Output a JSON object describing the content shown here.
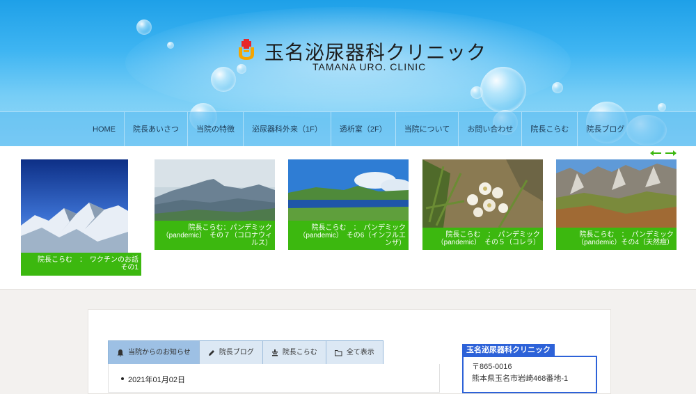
{
  "header": {
    "title": "玉名泌尿器科クリニック",
    "subtitle": "TAMANA URO. CLINIC"
  },
  "nav": {
    "items": [
      "HOME",
      "院長あいさつ",
      "当院の特徴",
      "泌尿器科外来（1F）",
      "透析室（2F）",
      "当院について",
      "お問い合わせ",
      "院長こらむ",
      "院長ブログ"
    ]
  },
  "slider": {
    "cards": [
      {
        "caption": "院長こらむ　：　ワクチンのお話　その1",
        "scene": "snow-mountain"
      },
      {
        "caption": "院長こらむ：パンデミック（pandemic）　その７（コロナウィルス）",
        "scene": "hazy-ridge"
      },
      {
        "caption": "院長こらむ　：　パンデミック（pandemic）　その6（インフルエンザ）",
        "scene": "mountain-lake"
      },
      {
        "caption": "院長こらむ　：　パンデミック（pandemic）　その５（コレラ）",
        "scene": "edelweiss"
      },
      {
        "caption": "院長こらむ　：　パンデミック（pandemic）その4（天然痘）",
        "scene": "alpine-valley"
      }
    ]
  },
  "tabs": [
    {
      "label": "当院からのお知らせ",
      "icon": "bell-icon"
    },
    {
      "label": "院長ブログ",
      "icon": "pencil-icon"
    },
    {
      "label": "院長こらむ",
      "icon": "column-icon"
    },
    {
      "label": "全て表示",
      "icon": "folder-icon"
    }
  ],
  "news": {
    "items": [
      {
        "date": "2021年01月02日"
      }
    ]
  },
  "sidebar": {
    "title": "玉名泌尿器科クリニック",
    "postal": "〒865-0016",
    "address": "熊本県玉名市岩崎468番地-1"
  },
  "colors": {
    "accent_green": "#3cb80f",
    "sidebar_blue": "#2d62d8",
    "header_blue": "#1ea0e8"
  }
}
